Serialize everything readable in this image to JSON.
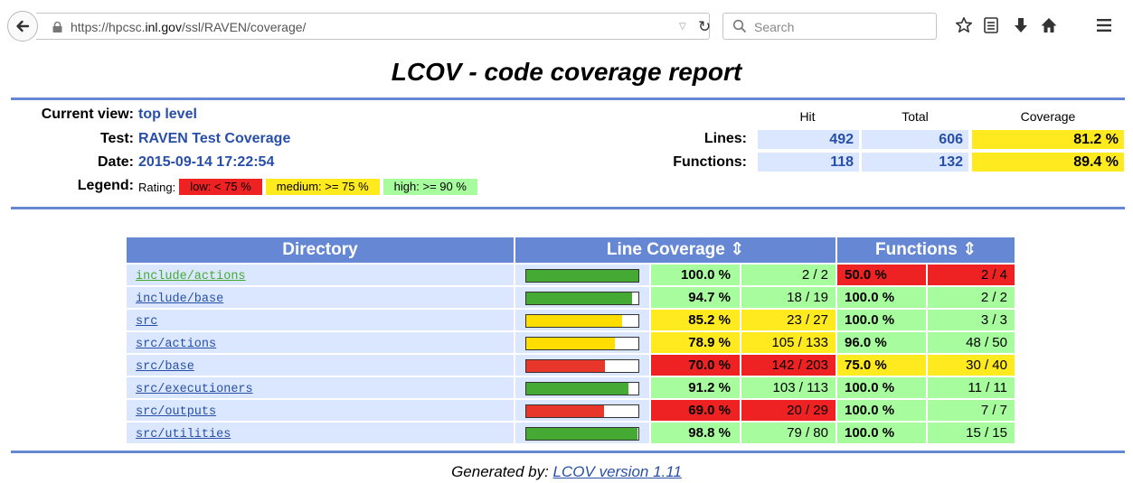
{
  "browser": {
    "url_prefix": "https://hpcsc.",
    "url_domain": "inl.gov",
    "url_path": "/ssl/RAVEN/coverage/",
    "search_placeholder": "Search"
  },
  "page": {
    "title": "LCOV - code coverage report"
  },
  "header": {
    "current_view_label": "Current view:",
    "current_view_value": "top level",
    "test_label": "Test:",
    "test_value": "RAVEN Test Coverage",
    "date_label": "Date:",
    "date_value": "2015-09-14 17:22:54",
    "legend_label": "Legend:",
    "rating_label": "Rating:",
    "legend_low": "low: < 75 %",
    "legend_medium": "medium: >= 75 %",
    "legend_high": "high: >= 90 %"
  },
  "summary": {
    "col_hit": "Hit",
    "col_total": "Total",
    "col_coverage": "Coverage",
    "lines_label": "Lines:",
    "lines_hit": "492",
    "lines_total": "606",
    "lines_coverage": "81.2 %",
    "functions_label": "Functions:",
    "functions_hit": "118",
    "functions_total": "132",
    "functions_coverage": "89.4 %"
  },
  "table": {
    "col_directory": "Directory",
    "col_line_coverage": "Line Coverage ⇕",
    "col_functions": "Functions ⇕",
    "rows": [
      {
        "dir": "include/actions",
        "visited": true,
        "line_pct": "100.0 %",
        "line_frac": "2 / 2",
        "line_level": "high",
        "bar_fraction": 1.0,
        "func_pct": "50.0 %",
        "func_frac": "2 / 4",
        "func_level": "low"
      },
      {
        "dir": "include/base",
        "visited": false,
        "line_pct": "94.7 %",
        "line_frac": "18 / 19",
        "line_level": "high",
        "bar_fraction": 0.947,
        "func_pct": "100.0 %",
        "func_frac": "2 / 2",
        "func_level": "high"
      },
      {
        "dir": "src",
        "visited": false,
        "line_pct": "85.2 %",
        "line_frac": "23 / 27",
        "line_level": "medium",
        "bar_fraction": 0.852,
        "func_pct": "100.0 %",
        "func_frac": "3 / 3",
        "func_level": "high"
      },
      {
        "dir": "src/actions",
        "visited": false,
        "line_pct": "78.9 %",
        "line_frac": "105 / 133",
        "line_level": "medium",
        "bar_fraction": 0.789,
        "func_pct": "96.0 %",
        "func_frac": "48 / 50",
        "func_level": "high"
      },
      {
        "dir": "src/base",
        "visited": false,
        "line_pct": "70.0 %",
        "line_frac": "142 / 203",
        "line_level": "low",
        "bar_fraction": 0.7,
        "func_pct": "75.0 %",
        "func_frac": "30 / 40",
        "func_level": "medium"
      },
      {
        "dir": "src/executioners",
        "visited": false,
        "line_pct": "91.2 %",
        "line_frac": "103 / 113",
        "line_level": "high",
        "bar_fraction": 0.912,
        "func_pct": "100.0 %",
        "func_frac": "11 / 11",
        "func_level": "high"
      },
      {
        "dir": "src/outputs",
        "visited": false,
        "line_pct": "69.0 %",
        "line_frac": "20 / 29",
        "line_level": "low",
        "bar_fraction": 0.69,
        "func_pct": "100.0 %",
        "func_frac": "7 / 7",
        "func_level": "high"
      },
      {
        "dir": "src/utilities",
        "visited": false,
        "line_pct": "98.8 %",
        "line_frac": "79 / 80",
        "line_level": "high",
        "bar_fraction": 0.988,
        "func_pct": "100.0 %",
        "func_frac": "15 / 15",
        "func_level": "high"
      }
    ]
  },
  "footer": {
    "prefix": "Generated by: ",
    "link": "LCOV version 1.11"
  },
  "colors": {
    "low": "#ee2222",
    "medium": "#ffea20",
    "high": "#a7fc9d",
    "bar_low": "#e8372a",
    "bar_medium": "#ffdd00",
    "bar_high": "#44aa33",
    "header_blue": "#6688d4",
    "cell_blue": "#dae7fe",
    "link_blue": "#284fa8",
    "visited_green": "#44aa33"
  },
  "icons": [
    "back-arrow-icon",
    "lock-icon",
    "dropdown-arrow-icon",
    "reload-icon",
    "search-icon",
    "bookmark-star-icon",
    "reading-list-icon",
    "download-icon",
    "home-icon",
    "menu-icon"
  ]
}
